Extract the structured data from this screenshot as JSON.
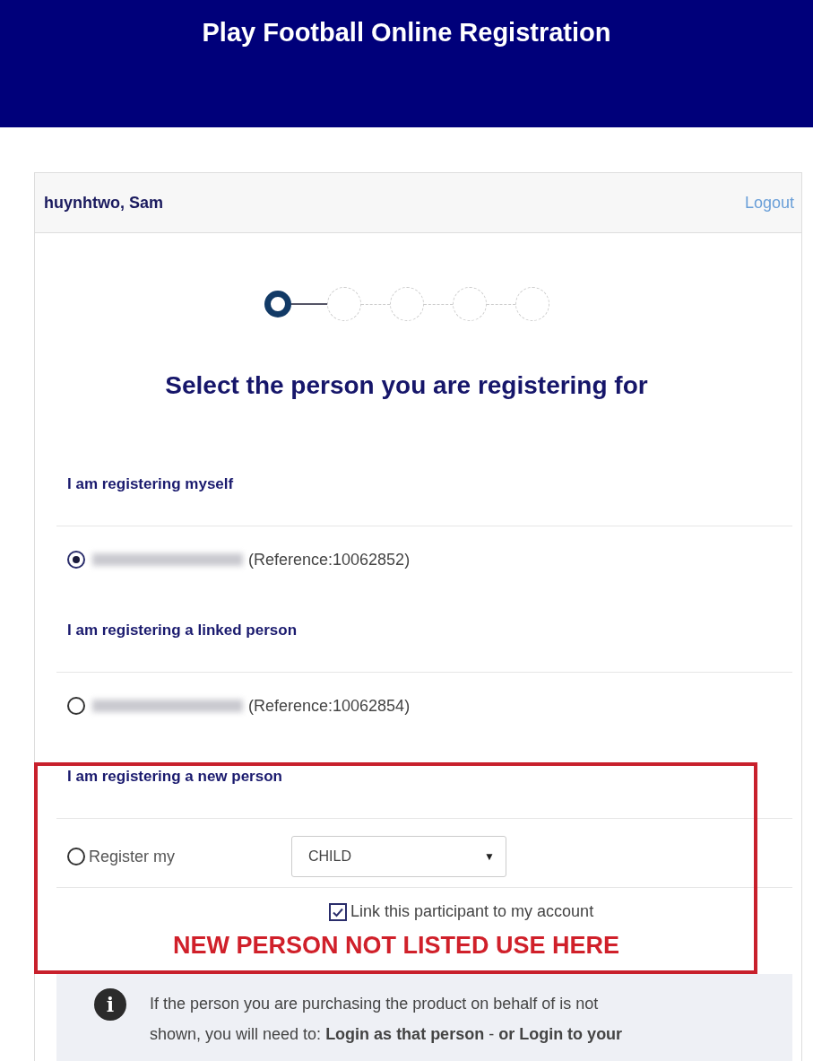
{
  "banner": {
    "title": "Play Football Online Registration"
  },
  "account": {
    "user": "huynhtwo, Sam",
    "logout": "Logout"
  },
  "steps": [
    {
      "selected": true
    },
    {
      "selected": false
    },
    {
      "selected": false
    },
    {
      "selected": false
    },
    {
      "selected": false
    }
  ],
  "heading": "Select the person you are registering for",
  "sections": [
    {
      "title": "I am registering myself",
      "kind": "person",
      "option": {
        "selected": true,
        "name_blurred": true,
        "reference": "(Reference:10062852)"
      }
    },
    {
      "title": "I am registering a linked person",
      "kind": "person",
      "option": {
        "selected": false,
        "name_blurred": true,
        "reference": "(Reference:10062854)"
      }
    },
    {
      "title": "I am registering a new person",
      "kind": "new",
      "option": {
        "selected": false,
        "label": "Register my",
        "select_value": "CHILD",
        "caret": "▼",
        "link_checkbox": {
          "label": "Link this participant to my account",
          "checked": true
        }
      }
    }
  ],
  "annotation": {
    "text": "NEW PERSON NOT LISTED USE HERE"
  },
  "info": {
    "icon": "i",
    "lines": [
      "If the person you are purchasing the product on behalf of is not",
      "shown, you will need to: **Login as that person** - **or Login to your**"
    ]
  }
}
